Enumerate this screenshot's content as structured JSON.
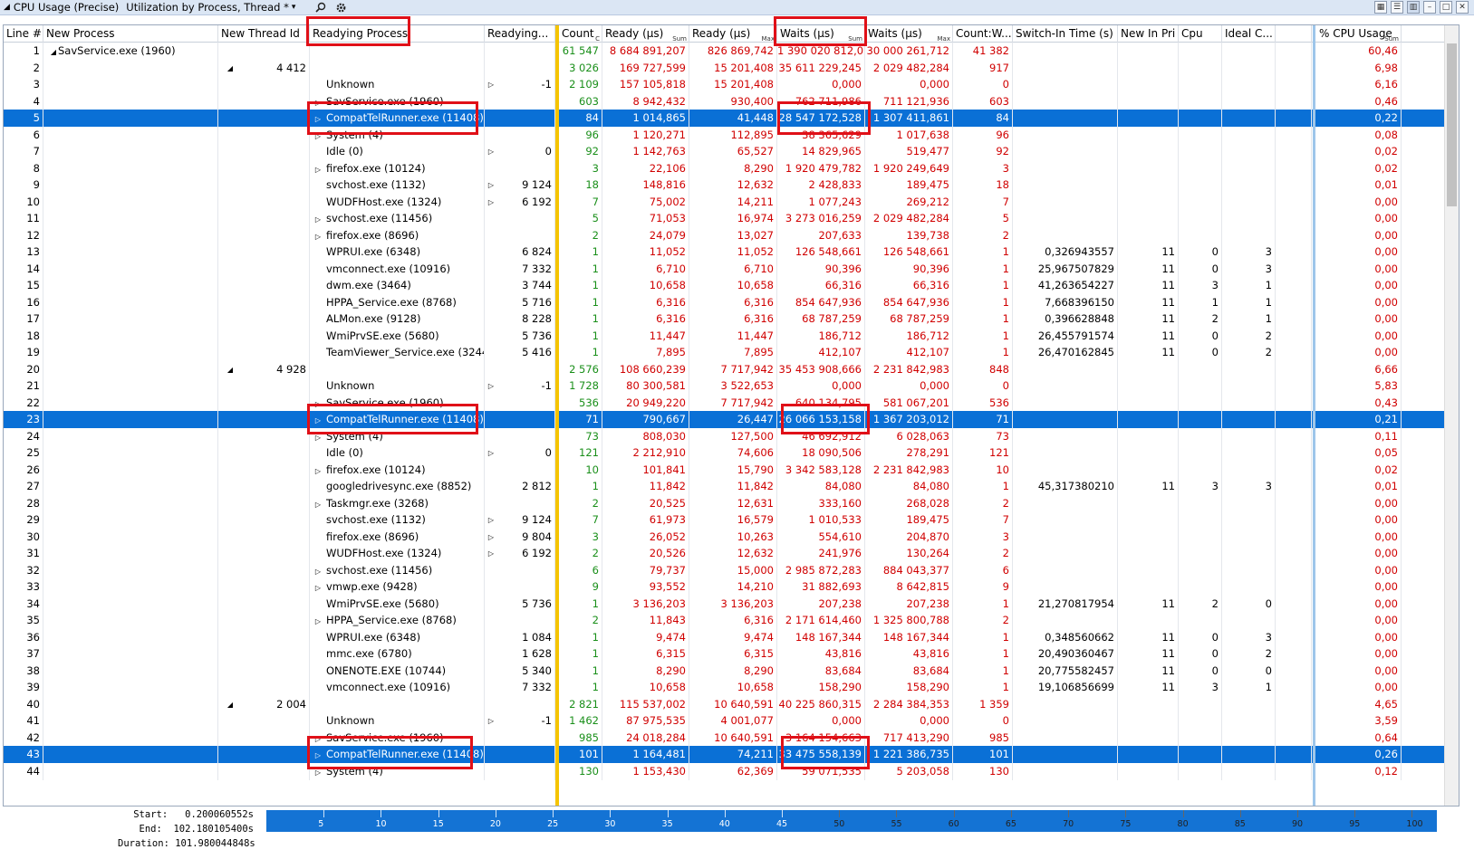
{
  "titlebar": {
    "collapse_glyph": "◢",
    "graph_name": "CPU Usage (Precise)",
    "preset": "Utilization by Process, Thread *",
    "dropdown_glyph": "▾"
  },
  "headers": {
    "line": "Line #",
    "new_process": "New Process",
    "new_thread": "New Thread Id",
    "readying_process": "Readying Process",
    "readying_thread": "Readying...",
    "count": "Count",
    "count_sub": "C",
    "ready_sum": "Ready (µs)",
    "ready_sum_sub": "Sum",
    "ready_max": "Ready (µs)",
    "ready_max_sub": "Max",
    "waits_sum": "Waits (µs)",
    "waits_sum_sub": "Sum",
    "waits_max": "Waits (µs)",
    "waits_max_sub": "Max",
    "count_w": "Count:W...",
    "switch_in": "Switch-In Time (s)",
    "new_in_pri": "New In Pri",
    "cpu": "Cpu",
    "ideal_c": "Ideal C...",
    "pct_cpu": "% CPU Usage",
    "pct_cpu_sub": "Sum"
  },
  "rows": [
    {
      "n": "1",
      "np": "SavService.exe (1960)",
      "npexp": "◢",
      "tid": "",
      "rp": "",
      "rpexp": "",
      "rt": "",
      "cnt": "61 547",
      "rs": "8 684 891,207",
      "rm": "826 869,742",
      "ws": "1 390 020 812,020",
      "wm": "30 000 261,712",
      "cw": "41 382",
      "sw": "",
      "pri": "",
      "cpu": "",
      "ic": "",
      "pct": "60,46"
    },
    {
      "n": "2",
      "np": "",
      "npexp": "",
      "tid": "4 412",
      "tidexp": "◢",
      "rp": "",
      "rpexp": "",
      "rt": "",
      "cnt": "3 026",
      "rs": "169 727,599",
      "rm": "15 201,408",
      "ws": "35 611 229,245",
      "wm": "2 029 482,284",
      "cw": "917",
      "sw": "",
      "pri": "",
      "cpu": "",
      "ic": "",
      "pct": "6,98"
    },
    {
      "n": "3",
      "rp": "Unknown",
      "rpexp": "",
      "rtexp": "▷",
      "rt": "-1",
      "cnt": "2 109",
      "rs": "157 105,818",
      "rm": "15 201,408",
      "ws": "0,000",
      "wm": "0,000",
      "cw": "0",
      "pct": "6,16"
    },
    {
      "n": "4",
      "rp": "SavService.exe (1960)",
      "rpexp": "▷",
      "rt": "",
      "cnt": "603",
      "rs": "8 942,432",
      "rm": "930,400",
      "ws": "762 711,986",
      "wm": "711 121,936",
      "cw": "603",
      "pct": "0,46"
    },
    {
      "n": "5",
      "sel": true,
      "rp": "CompatTelRunner.exe (11408)",
      "rpexp": "▷",
      "rt": "",
      "cnt": "84",
      "rs": "1 014,865",
      "rm": "41,448",
      "ws": "28 547 172,528",
      "wm": "1 307 411,861",
      "cw": "84",
      "pct": "0,22"
    },
    {
      "n": "6",
      "rp": "System (4)",
      "rpexp": "▷",
      "rt": "",
      "cnt": "96",
      "rs": "1 120,271",
      "rm": "112,895",
      "ws": "38 365,629",
      "wm": "1 017,638",
      "cw": "96",
      "pct": "0,08"
    },
    {
      "n": "7",
      "rp": "Idle (0)",
      "rpexp": "",
      "rtexp": "▷",
      "rt": "0",
      "cnt": "92",
      "rs": "1 142,763",
      "rm": "65,527",
      "ws": "14 829,965",
      "wm": "519,477",
      "cw": "92",
      "pct": "0,02"
    },
    {
      "n": "8",
      "rp": "firefox.exe (10124)",
      "rpexp": "▷",
      "rt": "",
      "cnt": "3",
      "rs": "22,106",
      "rm": "8,290",
      "ws": "1 920 479,782",
      "wm": "1 920 249,649",
      "cw": "3",
      "pct": "0,02"
    },
    {
      "n": "9",
      "rp": "svchost.exe (1132)",
      "rpexp": "",
      "rtexp": "▷",
      "rt": "9 124",
      "cnt": "18",
      "rs": "148,816",
      "rm": "12,632",
      "ws": "2 428,833",
      "wm": "189,475",
      "cw": "18",
      "pct": "0,01"
    },
    {
      "n": "10",
      "rp": "WUDFHost.exe (1324)",
      "rpexp": "",
      "rtexp": "▷",
      "rt": "6 192",
      "cnt": "7",
      "rs": "75,002",
      "rm": "14,211",
      "ws": "1 077,243",
      "wm": "269,212",
      "cw": "7",
      "pct": "0,00"
    },
    {
      "n": "11",
      "rp": "svchost.exe (11456)",
      "rpexp": "▷",
      "rt": "",
      "cnt": "5",
      "rs": "71,053",
      "rm": "16,974",
      "ws": "3 273 016,259",
      "wm": "2 029 482,284",
      "cw": "5",
      "pct": "0,00"
    },
    {
      "n": "12",
      "rp": "firefox.exe (8696)",
      "rpexp": "▷",
      "rt": "",
      "cnt": "2",
      "rs": "24,079",
      "rm": "13,027",
      "ws": "207,633",
      "wm": "139,738",
      "cw": "2",
      "pct": "0,00"
    },
    {
      "n": "13",
      "rp": "WPRUI.exe (6348)",
      "rpexp": "",
      "rt": "6 824",
      "cnt": "1",
      "rs": "11,052",
      "rm": "11,052",
      "ws": "126 548,661",
      "wm": "126 548,661",
      "cw": "1",
      "sw": "0,326943557",
      "pri": "11",
      "cpu": "0",
      "ic": "3",
      "pct": "0,00"
    },
    {
      "n": "14",
      "rp": "vmconnect.exe (10916)",
      "rpexp": "",
      "rt": "7 332",
      "cnt": "1",
      "rs": "6,710",
      "rm": "6,710",
      "ws": "90,396",
      "wm": "90,396",
      "cw": "1",
      "sw": "25,967507829",
      "pri": "11",
      "cpu": "0",
      "ic": "3",
      "pct": "0,00"
    },
    {
      "n": "15",
      "rp": "dwm.exe (3464)",
      "rpexp": "",
      "rt": "3 744",
      "cnt": "1",
      "rs": "10,658",
      "rm": "10,658",
      "ws": "66,316",
      "wm": "66,316",
      "cw": "1",
      "sw": "41,263654227",
      "pri": "11",
      "cpu": "3",
      "ic": "1",
      "pct": "0,00"
    },
    {
      "n": "16",
      "rp": "HPPA_Service.exe (8768)",
      "rpexp": "",
      "rt": "5 716",
      "cnt": "1",
      "rs": "6,316",
      "rm": "6,316",
      "ws": "854 647,936",
      "wm": "854 647,936",
      "cw": "1",
      "sw": "7,668396150",
      "pri": "11",
      "cpu": "1",
      "ic": "1",
      "pct": "0,00"
    },
    {
      "n": "17",
      "rp": "ALMon.exe (9128)",
      "rpexp": "",
      "rt": "8 228",
      "cnt": "1",
      "rs": "6,316",
      "rm": "6,316",
      "ws": "68 787,259",
      "wm": "68 787,259",
      "cw": "1",
      "sw": "0,396628848",
      "pri": "11",
      "cpu": "2",
      "ic": "1",
      "pct": "0,00"
    },
    {
      "n": "18",
      "rp": "WmiPrvSE.exe (5680)",
      "rpexp": "",
      "rt": "5 736",
      "cnt": "1",
      "rs": "11,447",
      "rm": "11,447",
      "ws": "186,712",
      "wm": "186,712",
      "cw": "1",
      "sw": "26,455791574",
      "pri": "11",
      "cpu": "0",
      "ic": "2",
      "pct": "0,00"
    },
    {
      "n": "19",
      "rp": "TeamViewer_Service.exe (3244)",
      "rpexp": "",
      "rt": "5 416",
      "cnt": "1",
      "rs": "7,895",
      "rm": "7,895",
      "ws": "412,107",
      "wm": "412,107",
      "cw": "1",
      "sw": "26,470162845",
      "pri": "11",
      "cpu": "0",
      "ic": "2",
      "pct": "0,00"
    },
    {
      "n": "20",
      "tid": "4 928",
      "tidexp": "◢",
      "rp": "",
      "cnt": "2 576",
      "rs": "108 660,239",
      "rm": "7 717,942",
      "ws": "35 453 908,666",
      "wm": "2 231 842,983",
      "cw": "848",
      "pct": "6,66"
    },
    {
      "n": "21",
      "rp": "Unknown",
      "rpexp": "",
      "rtexp": "▷",
      "rt": "-1",
      "cnt": "1 728",
      "rs": "80 300,581",
      "rm": "3 522,653",
      "ws": "0,000",
      "wm": "0,000",
      "cw": "0",
      "pct": "5,83"
    },
    {
      "n": "22",
      "rp": "SavService.exe (1960)",
      "rpexp": "▷",
      "rt": "",
      "cnt": "536",
      "rs": "20 949,220",
      "rm": "7 717,942",
      "ws": "640 134,795",
      "wm": "581 067,201",
      "cw": "536",
      "pct": "0,43"
    },
    {
      "n": "23",
      "sel": true,
      "rp": "CompatTelRunner.exe (11408)",
      "rpexp": "▷",
      "rt": "",
      "cnt": "71",
      "rs": "790,667",
      "rm": "26,447",
      "ws": "26 066 153,158",
      "wm": "1 367 203,012",
      "cw": "71",
      "pct": "0,21"
    },
    {
      "n": "24",
      "rp": "System (4)",
      "rpexp": "▷",
      "rt": "",
      "cnt": "73",
      "rs": "808,030",
      "rm": "127,500",
      "ws": "46 692,912",
      "wm": "6 028,063",
      "cw": "73",
      "pct": "0,11"
    },
    {
      "n": "25",
      "rp": "Idle (0)",
      "rpexp": "",
      "rtexp": "▷",
      "rt": "0",
      "cnt": "121",
      "rs": "2 212,910",
      "rm": "74,606",
      "ws": "18 090,506",
      "wm": "278,291",
      "cw": "121",
      "pct": "0,05"
    },
    {
      "n": "26",
      "rp": "firefox.exe (10124)",
      "rpexp": "▷",
      "rt": "",
      "cnt": "10",
      "rs": "101,841",
      "rm": "15,790",
      "ws": "3 342 583,128",
      "wm": "2 231 842,983",
      "cw": "10",
      "pct": "0,02"
    },
    {
      "n": "27",
      "rp": "googledrivesync.exe (8852)",
      "rpexp": "",
      "rt": "2 812",
      "cnt": "1",
      "rs": "11,842",
      "rm": "11,842",
      "ws": "84,080",
      "wm": "84,080",
      "cw": "1",
      "sw": "45,317380210",
      "pri": "11",
      "cpu": "3",
      "ic": "3",
      "pct": "0,01"
    },
    {
      "n": "28",
      "rp": "Taskmgr.exe (3268)",
      "rpexp": "▷",
      "rt": "",
      "cnt": "2",
      "rs": "20,525",
      "rm": "12,631",
      "ws": "333,160",
      "wm": "268,028",
      "cw": "2",
      "pct": "0,00"
    },
    {
      "n": "29",
      "rp": "svchost.exe (1132)",
      "rpexp": "",
      "rtexp": "▷",
      "rt": "9 124",
      "cnt": "7",
      "rs": "61,973",
      "rm": "16,579",
      "ws": "1 010,533",
      "wm": "189,475",
      "cw": "7",
      "pct": "0,00"
    },
    {
      "n": "30",
      "rp": "firefox.exe (8696)",
      "rpexp": "",
      "rtexp": "▷",
      "rt": "9 804",
      "cnt": "3",
      "rs": "26,052",
      "rm": "10,263",
      "ws": "554,610",
      "wm": "204,870",
      "cw": "3",
      "pct": "0,00"
    },
    {
      "n": "31",
      "rp": "WUDFHost.exe (1324)",
      "rpexp": "",
      "rtexp": "▷",
      "rt": "6 192",
      "cnt": "2",
      "rs": "20,526",
      "rm": "12,632",
      "ws": "241,976",
      "wm": "130,264",
      "cw": "2",
      "pct": "0,00"
    },
    {
      "n": "32",
      "rp": "svchost.exe (11456)",
      "rpexp": "▷",
      "rt": "",
      "cnt": "6",
      "rs": "79,737",
      "rm": "15,000",
      "ws": "2 985 872,283",
      "wm": "884 043,377",
      "cw": "6",
      "pct": "0,00"
    },
    {
      "n": "33",
      "rp": "vmwp.exe (9428)",
      "rpexp": "▷",
      "rt": "",
      "cnt": "9",
      "rs": "93,552",
      "rm": "14,210",
      "ws": "31 882,693",
      "wm": "8 642,815",
      "cw": "9",
      "pct": "0,00"
    },
    {
      "n": "34",
      "rp": "WmiPrvSE.exe (5680)",
      "rpexp": "",
      "rt": "5 736",
      "cnt": "1",
      "rs": "3 136,203",
      "rm": "3 136,203",
      "ws": "207,238",
      "wm": "207,238",
      "cw": "1",
      "sw": "21,270817954",
      "pri": "11",
      "cpu": "2",
      "ic": "0",
      "pct": "0,00"
    },
    {
      "n": "35",
      "rp": "HPPA_Service.exe (8768)",
      "rpexp": "▷",
      "rt": "",
      "cnt": "2",
      "rs": "11,843",
      "rm": "6,316",
      "ws": "2 171 614,460",
      "wm": "1 325 800,788",
      "cw": "2",
      "pct": "0,00"
    },
    {
      "n": "36",
      "rp": "WPRUI.exe (6348)",
      "rpexp": "",
      "rt": "1 084",
      "cnt": "1",
      "rs": "9,474",
      "rm": "9,474",
      "ws": "148 167,344",
      "wm": "148 167,344",
      "cw": "1",
      "sw": "0,348560662",
      "pri": "11",
      "cpu": "0",
      "ic": "3",
      "pct": "0,00"
    },
    {
      "n": "37",
      "rp": "mmc.exe (6780)",
      "rpexp": "",
      "rt": "1 628",
      "cnt": "1",
      "rs": "6,315",
      "rm": "6,315",
      "ws": "43,816",
      "wm": "43,816",
      "cw": "1",
      "sw": "20,490360467",
      "pri": "11",
      "cpu": "0",
      "ic": "2",
      "pct": "0,00"
    },
    {
      "n": "38",
      "rp": "ONENOTE.EXE (10744)",
      "rpexp": "",
      "rt": "5 340",
      "cnt": "1",
      "rs": "8,290",
      "rm": "8,290",
      "ws": "83,684",
      "wm": "83,684",
      "cw": "1",
      "sw": "20,775582457",
      "pri": "11",
      "cpu": "0",
      "ic": "0",
      "pct": "0,00"
    },
    {
      "n": "39",
      "rp": "vmconnect.exe (10916)",
      "rpexp": "",
      "rt": "7 332",
      "cnt": "1",
      "rs": "10,658",
      "rm": "10,658",
      "ws": "158,290",
      "wm": "158,290",
      "cw": "1",
      "sw": "19,106856699",
      "pri": "11",
      "cpu": "3",
      "ic": "1",
      "pct": "0,00"
    },
    {
      "n": "40",
      "tid": "2 004",
      "tidexp": "◢",
      "rp": "",
      "cnt": "2 821",
      "rs": "115 537,002",
      "rm": "10 640,591",
      "ws": "40 225 860,315",
      "wm": "2 284 384,353",
      "cw": "1 359",
      "pct": "4,65"
    },
    {
      "n": "41",
      "rp": "Unknown",
      "rpexp": "",
      "rtexp": "▷",
      "rt": "-1",
      "cnt": "1 462",
      "rs": "87 975,535",
      "rm": "4 001,077",
      "ws": "0,000",
      "wm": "0,000",
      "cw": "0",
      "pct": "3,59"
    },
    {
      "n": "42",
      "rp": "SavService.exe (1960)",
      "rpexp": "▷",
      "rt": "",
      "cnt": "985",
      "rs": "24 018,284",
      "rm": "10 640,591",
      "ws": "3 164 154,663",
      "wm": "717 413,290",
      "cw": "985",
      "pct": "0,64"
    },
    {
      "n": "43",
      "sel": true,
      "rp": "CompatTelRunner.exe (11408)",
      "rpexp": "▷",
      "rt": "",
      "cnt": "101",
      "rs": "1 164,481",
      "rm": "74,211",
      "ws": "33 475 558,139",
      "wm": "1 221 386,735",
      "cw": "101",
      "pct": "0,26"
    },
    {
      "n": "44",
      "rp": "System (4)",
      "rpexp": "▷",
      "rt": "",
      "cnt": "130",
      "rs": "1 153,430",
      "rm": "62,369",
      "ws": "59 071,535",
      "wm": "5 203,058",
      "cw": "130",
      "pct": "0,12"
    }
  ],
  "timeline": {
    "start_label": "Start:",
    "start_val": "0.200060552s",
    "end_label": "End:",
    "end_val": "102.180105400s",
    "dur_label": "Duration:",
    "dur_val": "101.980044848s",
    "ticks": [
      "5",
      "10",
      "15",
      "20",
      "25",
      "30",
      "35",
      "40",
      "45",
      "50",
      "55",
      "60",
      "65",
      "70",
      "75",
      "80",
      "85",
      "90",
      "95",
      "100"
    ]
  },
  "colors": {
    "selection": "#0a70d6",
    "red_values": "#d00000",
    "green_values": "#1a8f1a",
    "highlight_box": "#e01018",
    "divider": "#f5c400"
  }
}
